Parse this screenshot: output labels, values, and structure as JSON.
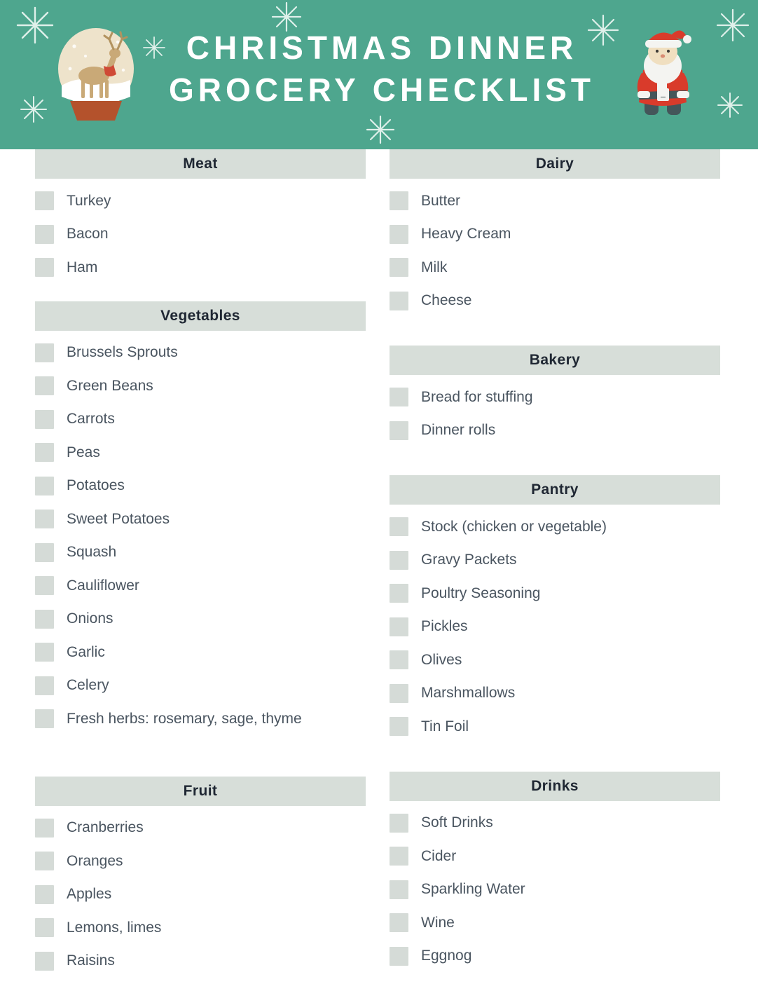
{
  "header": {
    "title_line1": "CHRISTMAS DINNER",
    "title_line2": "GROCERY CHECKLIST",
    "background_color": "#4ea68e",
    "title_color": "#ffffff",
    "left_decoration": "snow-globe-with-reindeer",
    "right_decoration": "santa-claus",
    "snowflake_count": 8
  },
  "theme": {
    "section_header_bg": "#d7ded9",
    "section_header_text": "#1f2733",
    "checkbox_fill": "#d5dbd7",
    "item_text": "#4a5560",
    "page_bg": "#ffffff"
  },
  "columns": [
    {
      "id": "left",
      "sections": [
        {
          "title": "Meat",
          "items": [
            "Turkey",
            "Bacon",
            "Ham"
          ]
        },
        {
          "title": "Vegetables",
          "items": [
            "Brussels Sprouts",
            "Green Beans",
            "Carrots",
            "Peas",
            "Potatoes",
            "Sweet Potatoes",
            "Squash",
            "Cauliflower",
            "Onions",
            "Garlic",
            "Celery",
            "Fresh herbs: rosemary, sage, thyme"
          ]
        },
        {
          "title": "Fruit",
          "items": [
            "Cranberries",
            "Oranges",
            "Apples",
            "Lemons, limes",
            "Raisins"
          ]
        }
      ]
    },
    {
      "id": "right",
      "sections": [
        {
          "title": "Dairy",
          "items": [
            "Butter",
            "Heavy Cream",
            "Milk",
            "Cheese"
          ]
        },
        {
          "title": "Bakery",
          "items": [
            "Bread for stuffing",
            "Dinner rolls"
          ]
        },
        {
          "title": "Pantry",
          "items": [
            "Stock (chicken or vegetable)",
            "Gravy Packets",
            "Poultry Seasoning",
            "Pickles",
            "Olives",
            "Marshmallows",
            "Tin Foil"
          ]
        },
        {
          "title": "Drinks",
          "items": [
            "Soft Drinks",
            "Cider",
            "Sparkling Water",
            "Wine",
            "Eggnog"
          ]
        }
      ]
    }
  ]
}
